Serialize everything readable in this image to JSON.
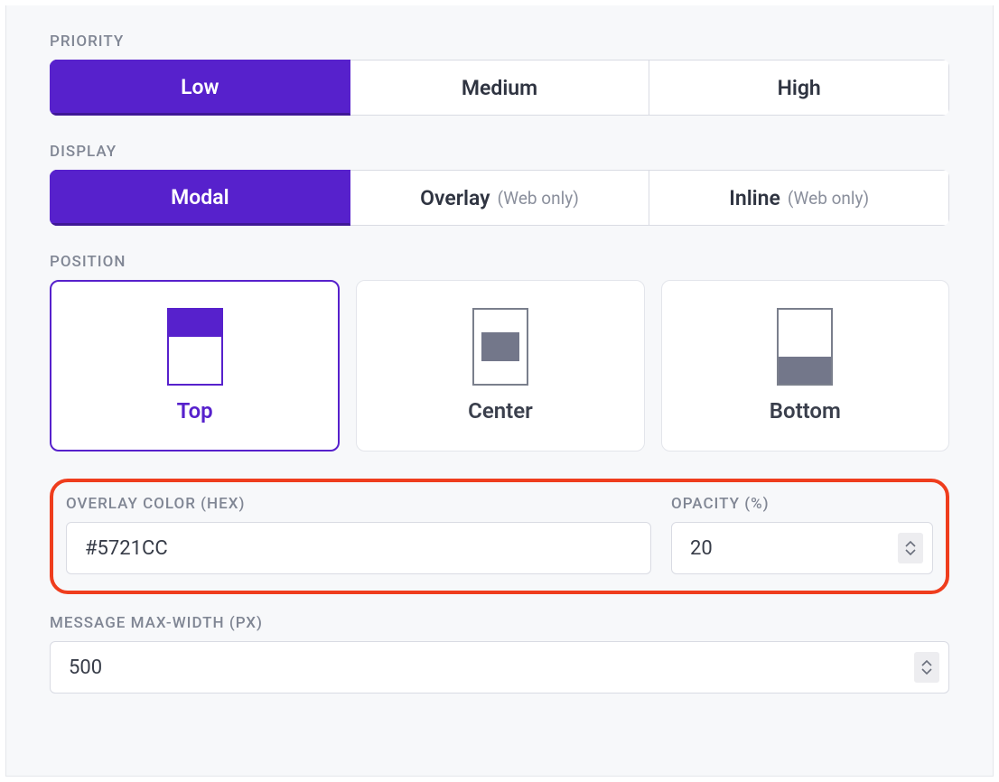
{
  "priority": {
    "label": "PRIORITY",
    "options": {
      "low": "Low",
      "medium": "Medium",
      "high": "High"
    },
    "selected": "low"
  },
  "display": {
    "label": "DISPLAY",
    "options": {
      "modal": {
        "label": "Modal",
        "sub": ""
      },
      "overlay": {
        "label": "Overlay",
        "sub": "(Web only)"
      },
      "inline": {
        "label": "Inline",
        "sub": "(Web only)"
      }
    },
    "selected": "modal"
  },
  "position": {
    "label": "POSITION",
    "options": {
      "top": "Top",
      "center": "Center",
      "bottom": "Bottom"
    },
    "selected": "top"
  },
  "overlay_color": {
    "label": "OVERLAY COLOR (HEX)",
    "value": "#5721CC"
  },
  "opacity": {
    "label": "OPACITY (%)",
    "value": "20"
  },
  "max_width": {
    "label": "MESSAGE MAX-WIDTH (PX)",
    "value": "500"
  },
  "colors": {
    "accent": "#5721cc",
    "highlight_border": "#ef3d1d"
  }
}
